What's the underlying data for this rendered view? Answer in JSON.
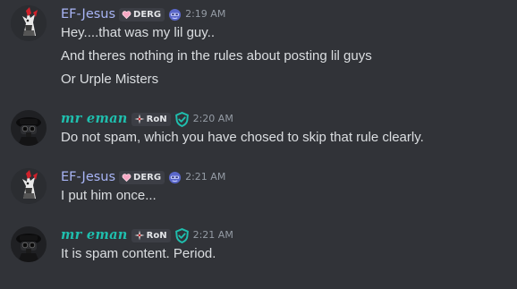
{
  "colors": {
    "background": "#313338",
    "ef_username": "#a8b5f6",
    "eman_username": "#1fbfae",
    "text": "#dbdee1",
    "timestamp": "#949ba4"
  },
  "messages": [
    {
      "author": "EF-Jesus",
      "tag": "DERG",
      "tag_icon": "heart-icon",
      "badge_icon": "blue-face-icon",
      "timestamp": "2:19 AM",
      "lines": [
        "Hey....that was my lil guy..",
        "And theres nothing in the rules about posting lil guys",
        "Or Urple Misters"
      ]
    },
    {
      "author": "mr eman",
      "tag": "RoN",
      "tag_icon": "compass-star-icon",
      "badge_icon": "shield-check-icon",
      "timestamp": "2:20 AM",
      "lines": [
        "Do not spam, which you have chosed to skip that rule clearly."
      ]
    },
    {
      "author": "EF-Jesus",
      "tag": "DERG",
      "tag_icon": "heart-icon",
      "badge_icon": "blue-face-icon",
      "timestamp": "2:21 AM",
      "lines": [
        "I put him once..."
      ]
    },
    {
      "author": "mr eman",
      "tag": "RoN",
      "tag_icon": "compass-star-icon",
      "badge_icon": "shield-check-icon",
      "timestamp": "2:21 AM",
      "lines": [
        "It is spam content. Period."
      ]
    }
  ]
}
